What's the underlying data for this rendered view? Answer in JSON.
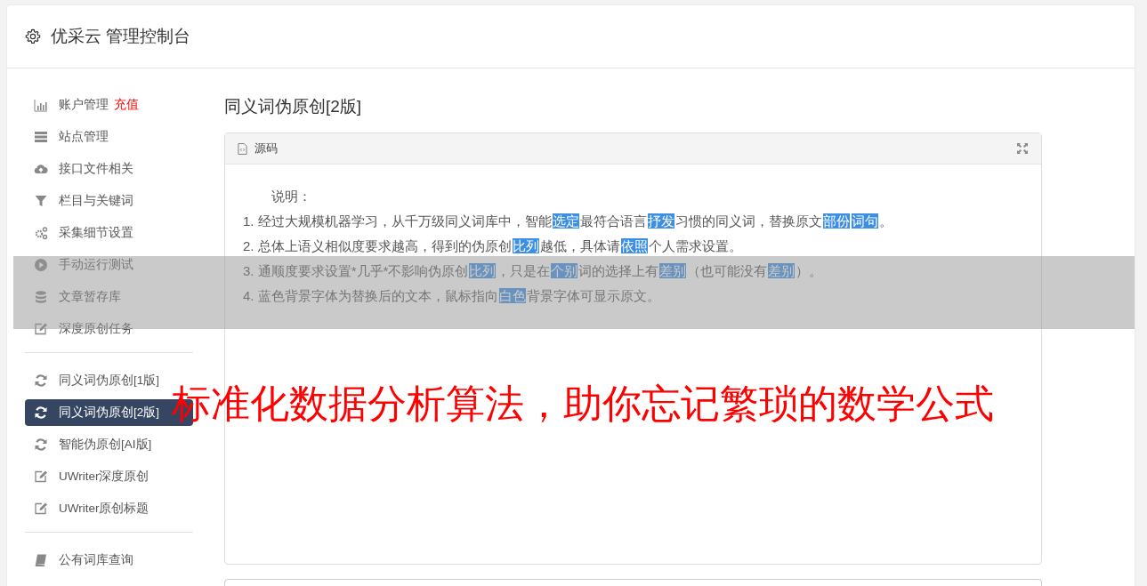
{
  "header": {
    "title": "优采云 管理控制台"
  },
  "sidebar": {
    "groups": [
      [
        {
          "label": "账户管理",
          "badge": "充值",
          "kind": "chart",
          "selected": false
        },
        {
          "label": "站点管理",
          "kind": "server",
          "selected": false
        },
        {
          "label": "接口文件相关",
          "kind": "cloud",
          "selected": false
        },
        {
          "label": "栏目与关键词",
          "kind": "filter",
          "selected": false
        },
        {
          "label": "采集细节设置",
          "kind": "gears",
          "selected": false
        },
        {
          "label": "手动运行测试",
          "kind": "play",
          "selected": false
        },
        {
          "label": "文章暂存库",
          "kind": "database",
          "selected": false
        },
        {
          "label": "深度原创任务",
          "kind": "edit",
          "selected": false
        }
      ],
      [
        {
          "label": "同义词伪原创[1版]",
          "kind": "refresh",
          "selected": false
        },
        {
          "label": "同义词伪原创[2版]",
          "kind": "refresh",
          "selected": true
        },
        {
          "label": "智能伪原创[AI版]",
          "kind": "refresh",
          "selected": false
        },
        {
          "label": "UWriter深度原创",
          "kind": "edit",
          "selected": false
        },
        {
          "label": "UWriter原创标题",
          "kind": "edit",
          "selected": false
        }
      ],
      [
        {
          "label": "公有词库查询",
          "kind": "book",
          "selected": false
        }
      ]
    ]
  },
  "content": {
    "title": "同义词伪原创[2版]",
    "panel": {
      "title": "源码",
      "lead": "说明：",
      "lines": [
        [
          {
            "text": "1. 经过大规模机器学习，从千万级同义词库中，智能",
            "highlighted": false
          },
          {
            "text": "选定",
            "highlighted": true
          },
          {
            "text": "最符合语言",
            "highlighted": false
          },
          {
            "text": "抒发",
            "highlighted": true
          },
          {
            "text": "习惯的同义词，替换原文",
            "highlighted": false
          },
          {
            "text": "部份",
            "highlighted": true
          },
          {
            "text": "词句",
            "highlighted": true
          },
          {
            "text": "。",
            "highlighted": false
          }
        ],
        [
          {
            "text": "2. 总体上语义相似度要求越高，得到的伪原创",
            "highlighted": false
          },
          {
            "text": "比列",
            "highlighted": true
          },
          {
            "text": "越低，具体请",
            "highlighted": false
          },
          {
            "text": "依照",
            "highlighted": true
          },
          {
            "text": "个人需求设置。",
            "highlighted": false
          }
        ],
        [
          {
            "text": "3. 通顺度要求设置*几乎*不影响伪原创",
            "highlighted": false
          },
          {
            "text": "比列",
            "highlighted": true
          },
          {
            "text": "，只是在",
            "highlighted": false
          },
          {
            "text": "个别",
            "highlighted": true
          },
          {
            "text": "词的选择上有",
            "highlighted": false
          },
          {
            "text": "差别",
            "highlighted": true
          },
          {
            "text": "（也可能没有",
            "highlighted": false
          },
          {
            "text": "差别",
            "highlighted": true
          },
          {
            "text": "）。",
            "highlighted": false
          }
        ],
        [
          {
            "text": "4. 蓝色背景字体为替换后的文本，鼠标指向",
            "highlighted": false
          },
          {
            "text": "白色",
            "highlighted": true
          },
          {
            "text": "背景字体可显示原文。",
            "highlighted": false
          }
        ]
      ]
    }
  },
  "overlay": {
    "headline": "标准化数据分析算法，助你忘记繁琐的数学公式"
  }
}
